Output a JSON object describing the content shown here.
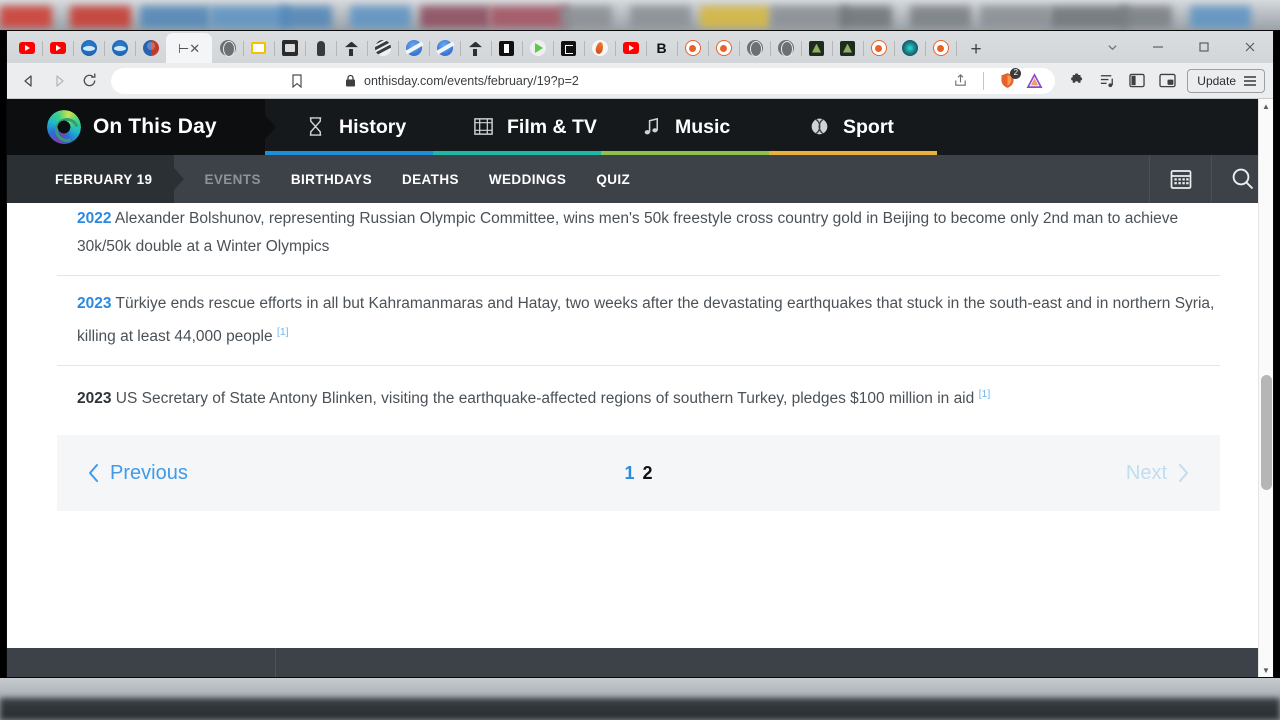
{
  "browser": {
    "name": "brave-browser",
    "url": "onthisday.com/events/february/19?p=2",
    "lock_icon": "lock-icon",
    "back_icon": "back-arrow-icon",
    "forward_icon": "forward-arrow-icon",
    "reload_icon": "reload-icon",
    "bookmark_icon": "bookmark-icon",
    "share_icon": "share-icon",
    "shield_icon": "brave-shield-icon",
    "shield_badge": "2",
    "rewards_icon": "brave-rewards-triangle-icon",
    "extensions_icon": "extensions-puzzle-icon",
    "playlist_icon": "playlist-icon",
    "sidebar_icon": "sidebar-panel-icon",
    "pip_icon": "picture-in-picture-icon",
    "update_label": "Update",
    "menu_icon": "hamburger-menu-icon",
    "newtab_label": "+",
    "tab_search_icon": "chevron-down-icon",
    "minimize_icon": "minimize-icon",
    "maximize_icon": "maximize-icon",
    "close_icon": "close-icon",
    "tabs": [
      {
        "favicon": "youtube-icon",
        "cls": "fav-yt"
      },
      {
        "favicon": "youtube-icon",
        "cls": "fav-yt"
      },
      {
        "favicon": "blue-globe-icon",
        "cls": "fav fav-blue"
      },
      {
        "favicon": "blue-globe-icon",
        "cls": "fav fav-blue"
      },
      {
        "favicon": "yin-yang-icon",
        "cls": "fav fav-yy"
      },
      {
        "favicon": "close-tab-icon",
        "cls": "fav-x",
        "text": "⊢✕",
        "active": true
      },
      {
        "favicon": "grey-globe-icon",
        "cls": "fav fav-globe"
      },
      {
        "favicon": "yellow-window-icon",
        "cls": "fav-yellowbox"
      },
      {
        "favicon": "dark-screen-icon",
        "cls": "fav fav-dk"
      },
      {
        "favicon": "person-icon",
        "cls": "fav-person"
      },
      {
        "favicon": "tree-icon",
        "cls": "fav-tree"
      },
      {
        "favicon": "swirl-icon",
        "cls": "fav fav-swirl"
      },
      {
        "favicon": "blue-circle-icon",
        "cls": "fav fav-bblue"
      },
      {
        "favicon": "blue-circle-icon",
        "cls": "fav fav-bblue"
      },
      {
        "favicon": "tree-icon",
        "cls": "fav-tree"
      },
      {
        "favicon": "black-square-icon",
        "cls": "fav-black-sq"
      },
      {
        "favicon": "play-icon",
        "cls": "fav fav-play"
      },
      {
        "favicon": "e-badge-icon",
        "cls": "fav-e"
      },
      {
        "favicon": "flame-icon",
        "cls": "fav fav-flame"
      },
      {
        "favicon": "youtube-icon",
        "cls": "fav-yt"
      },
      {
        "favicon": "bold-b-icon",
        "cls": "fav-B",
        "text": "B"
      },
      {
        "favicon": "reddit-icon",
        "cls": "fav fav-reddit"
      },
      {
        "favicon": "reddit-icon",
        "cls": "fav fav-reddit"
      },
      {
        "favicon": "grey-globe-icon",
        "cls": "fav fav-globe"
      },
      {
        "favicon": "grey-globe-icon",
        "cls": "fav fav-globe"
      },
      {
        "favicon": "dark-green-icon",
        "cls": "fav-darkgrn"
      },
      {
        "favicon": "dark-green-icon",
        "cls": "fav-darkgrn"
      },
      {
        "favicon": "reddit-icon",
        "cls": "fav fav-reddit"
      },
      {
        "favicon": "teal-glow-icon",
        "cls": "fav fav-tealglow"
      },
      {
        "favicon": "reddit-icon",
        "cls": "fav fav-reddit"
      }
    ]
  },
  "site": {
    "brand": "On This Day",
    "logo_icon": "onthisday-swirl-logo",
    "topnav": [
      {
        "label": "History",
        "icon": "hourglass-icon",
        "color": "#1e8fd5"
      },
      {
        "label": "Film & TV",
        "icon": "film-strip-icon",
        "color": "#1fb7a6"
      },
      {
        "label": "Music",
        "icon": "music-note-icon",
        "color": "#8cc152"
      },
      {
        "label": "Sport",
        "icon": "baseball-icon",
        "color": "#e8b23a"
      }
    ],
    "date_chip": "FEBRUARY 19",
    "subnav": [
      {
        "label": "EVENTS",
        "muted": true
      },
      {
        "label": "BIRTHDAYS",
        "muted": false
      },
      {
        "label": "DEATHS",
        "muted": false
      },
      {
        "label": "WEDDINGS",
        "muted": false
      },
      {
        "label": "QUIZ",
        "muted": false
      }
    ],
    "calendar_icon": "calendar-icon",
    "search_icon": "search-icon"
  },
  "events": [
    {
      "year": "2022",
      "year_dark": false,
      "text": "Alexander Bolshunov, representing Russian Olympic Committee, wins men's 50k freestyle cross country gold in Beijing to become only 2nd man to achieve 30k/50k double at a Winter Olympics",
      "citation": ""
    },
    {
      "year": "2023",
      "year_dark": false,
      "text": "Türkiye ends rescue efforts in all but Kahramanmaras and Hatay, two weeks after the devastating earthquakes that stuck in the south-east and in northern Syria, killing at least 44,000 people",
      "citation": "[1]"
    },
    {
      "year": "2023",
      "year_dark": true,
      "text": "US Secretary of State Antony Blinken, visiting the earthquake-affected regions of southern Turkey, pledges $100 million in aid",
      "citation": "[1]"
    }
  ],
  "pagination": {
    "previous_label": "Previous",
    "previous_icon": "chevron-left-icon",
    "next_label": "Next",
    "next_icon": "chevron-right-icon",
    "next_disabled": true,
    "pages": [
      {
        "label": "1",
        "current": false
      },
      {
        "label": "2",
        "current": true
      }
    ]
  },
  "scrollbar": {
    "up_icon": "scroll-up-arrow-icon",
    "down_icon": "scroll-down-arrow-icon"
  }
}
